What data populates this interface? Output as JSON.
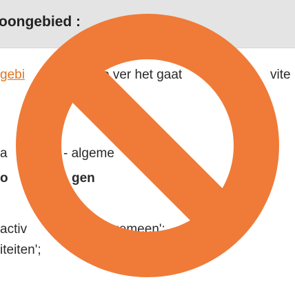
{
  "header": {
    "title": "oongebied :"
  },
  "content": {
    "line1_link": "gebi",
    "line1_text": "o ver het gaat",
    "line1_tail": "vite",
    "line2_left": "a",
    "line2_right": "- algeme",
    "line3_left": "o",
    "line3_right": "gen",
    "line4_left": "activ",
    "line4_right": "lgemeen';",
    "line5": "iteiten';"
  },
  "overlay": {
    "icon": "prohibition-icon",
    "color": "#f07a38"
  }
}
